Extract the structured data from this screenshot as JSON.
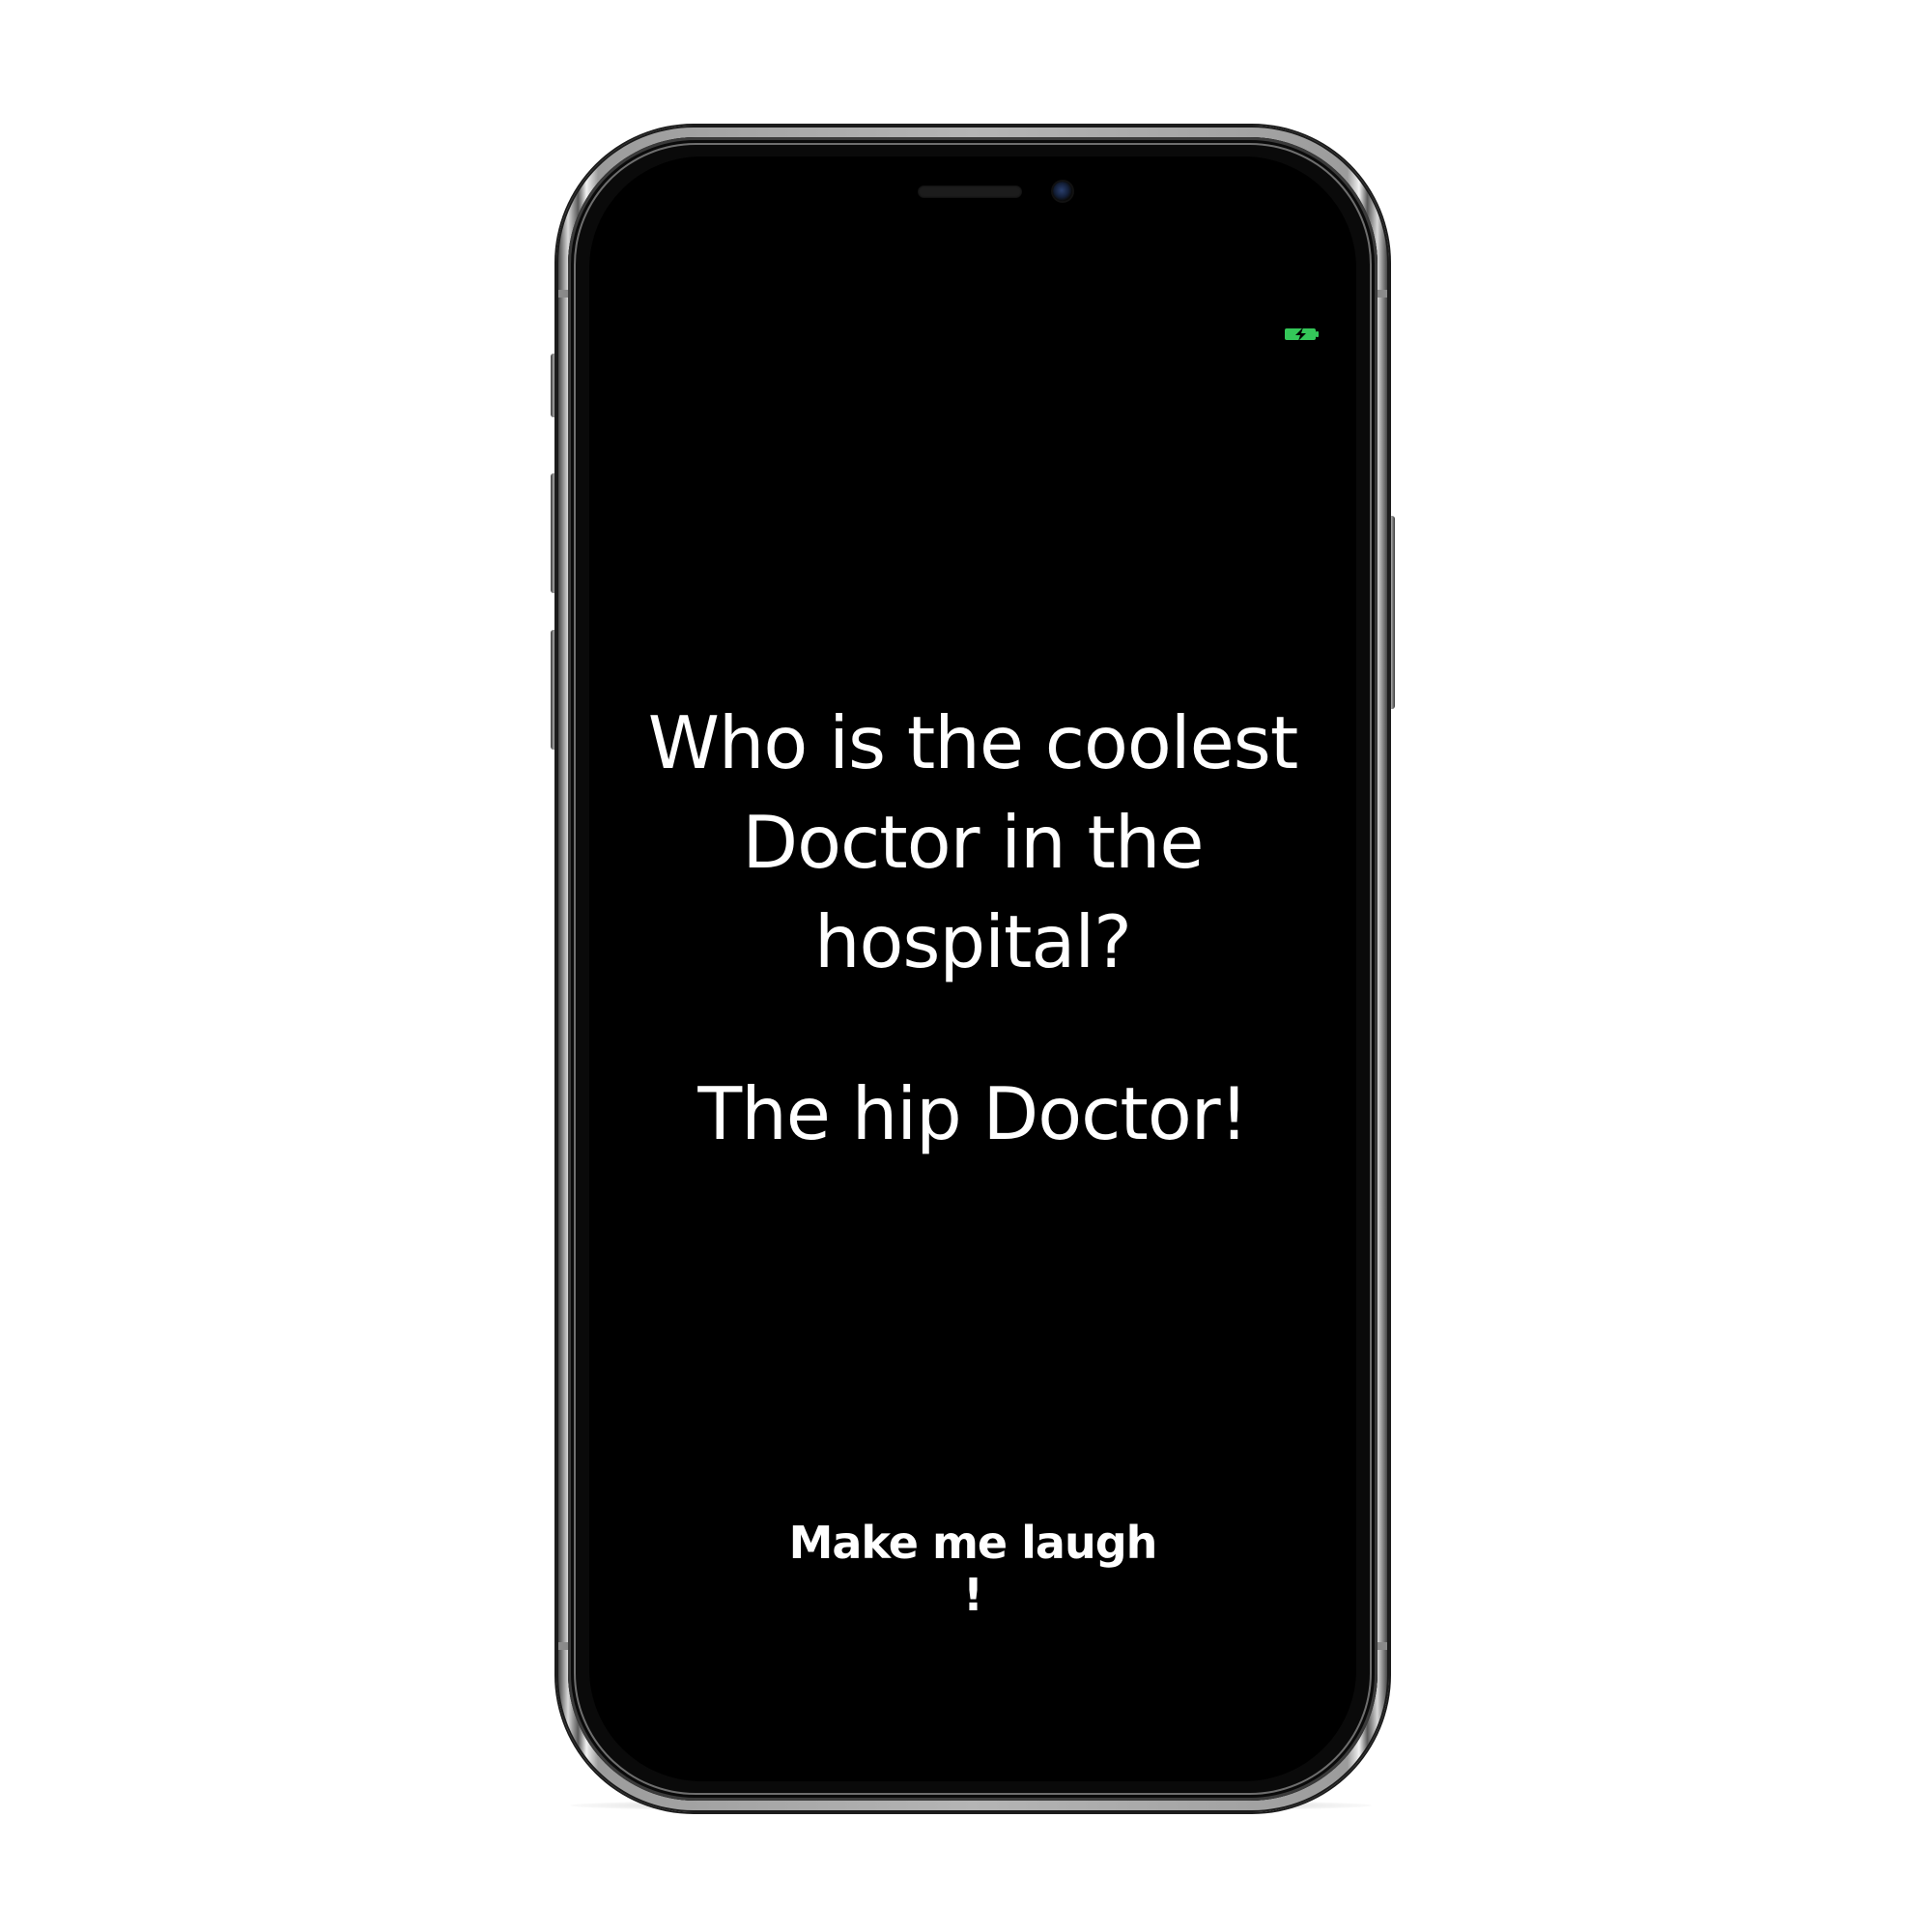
{
  "status_bar": {
    "battery_icon": "battery-charging-icon",
    "battery_color": "#34c759"
  },
  "joke": {
    "question": "Who is the coolest Doctor in the hospital?",
    "answer": "The hip Doctor!"
  },
  "actions": {
    "laugh_button_label": "Make me laugh !"
  },
  "colors": {
    "screen_background": "#000000",
    "text": "#ffffff"
  }
}
